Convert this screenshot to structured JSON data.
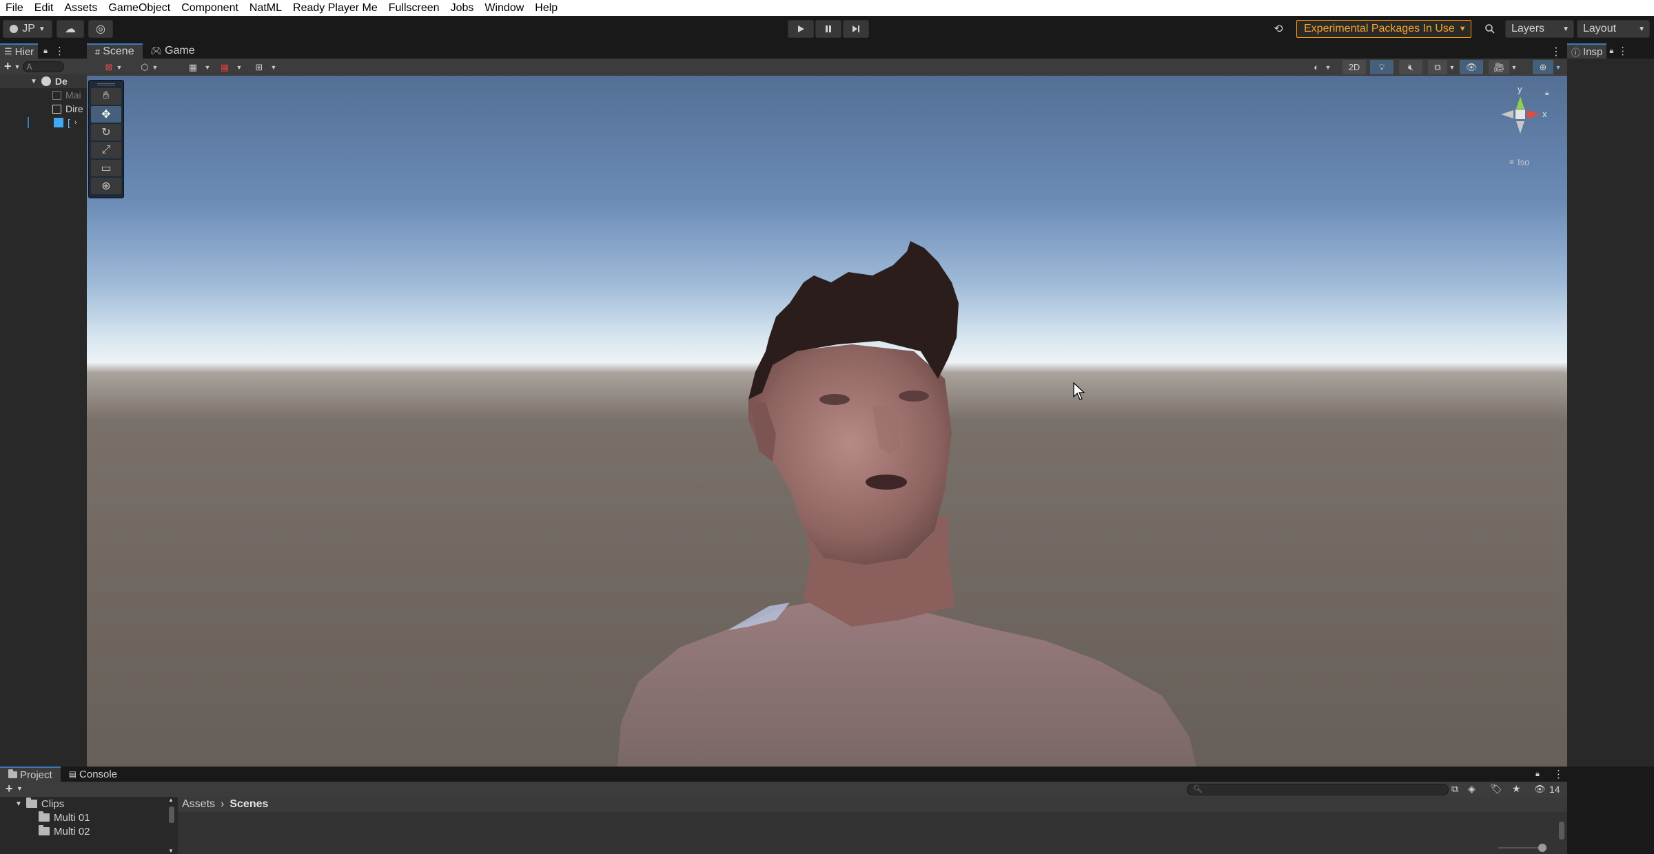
{
  "menu": [
    "File",
    "Edit",
    "Assets",
    "GameObject",
    "Component",
    "NatML",
    "Ready Player Me",
    "Fullscreen",
    "Jobs",
    "Window",
    "Help"
  ],
  "toolbar": {
    "account_label": "JP",
    "experimental_label": "Experimental Packages In Use",
    "layers_label": "Layers",
    "layout_label": "Layout"
  },
  "hierarchy": {
    "tab_label": "Hier",
    "search_placeholder": "A",
    "items": [
      {
        "label": "De",
        "kind": "scene"
      },
      {
        "label": "Mai",
        "kind": "faded"
      },
      {
        "label": "Dire",
        "kind": "object"
      },
      {
        "label": "[",
        "kind": "prefab"
      }
    ]
  },
  "scene": {
    "tabs": [
      "Scene",
      "Game"
    ],
    "btn_2d": "2D",
    "gizmo": {
      "y": "y",
      "x": "x",
      "view_label": "Iso"
    }
  },
  "inspector": {
    "tab_label": "Insp"
  },
  "project": {
    "tabs": [
      "Project",
      "Console"
    ],
    "breadcrumb": [
      "Assets",
      "Scenes"
    ],
    "tree": [
      "Clips",
      "Multi 01",
      "Multi 02"
    ],
    "hidden_count": "14"
  }
}
